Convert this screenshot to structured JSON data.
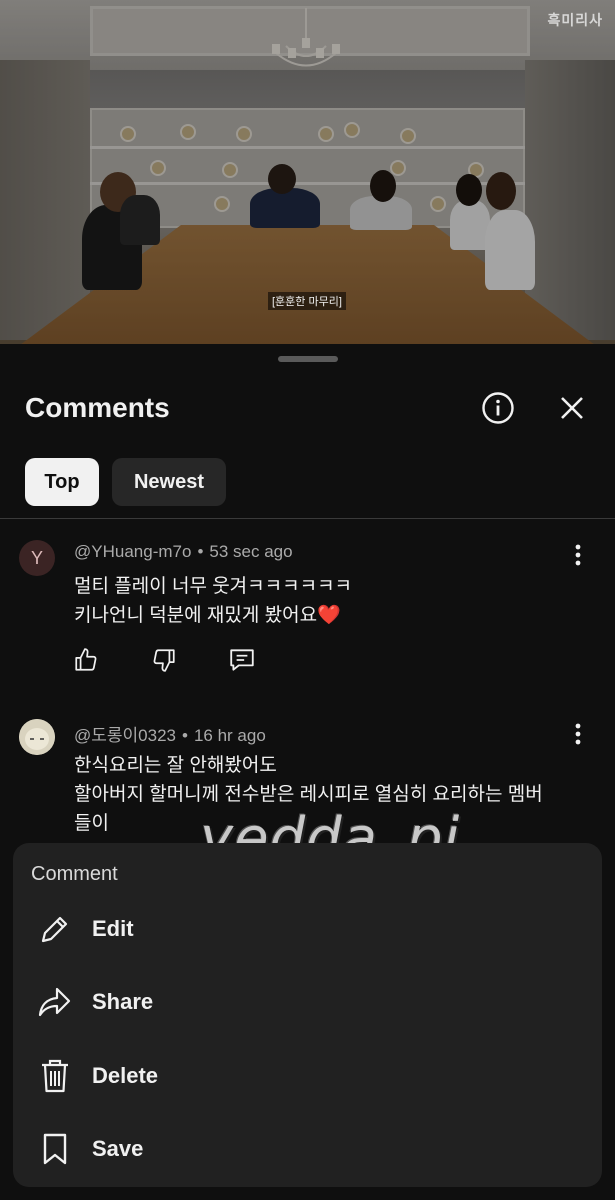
{
  "video": {
    "caption": "[훈훈한 마무리]",
    "channel_logo": "흑미리사"
  },
  "comments_sheet": {
    "title": "Comments",
    "info_icon": "info-icon",
    "close_icon": "close-icon",
    "filters": [
      {
        "label": "Top",
        "selected": true
      },
      {
        "label": "Newest",
        "selected": false
      }
    ]
  },
  "comments": [
    {
      "avatar_letter": "Y",
      "author": "@YHuang-m7o",
      "time": "53 sec ago",
      "text": "멀티 플레이 너무 웃겨ㅋㅋㅋㅋㅋㅋ\n키나언니 덕분에 재밌게 봤어요❤️"
    },
    {
      "author": "@도롱이0323",
      "time": "16 hr ago",
      "text": "한식요리는 잘 안해봤어도\n할아버지 할머니께 전수받은 레시피로 열심히 요리하는 멤버\n들이"
    }
  ],
  "menu": {
    "title": "Comment",
    "items": [
      {
        "label": "Edit",
        "icon": "pencil-icon"
      },
      {
        "label": "Share",
        "icon": "share-arrow-icon"
      },
      {
        "label": "Delete",
        "icon": "trash-icon"
      },
      {
        "label": "Save",
        "icon": "bookmark-icon"
      }
    ]
  },
  "watermark": "yedda_pj"
}
